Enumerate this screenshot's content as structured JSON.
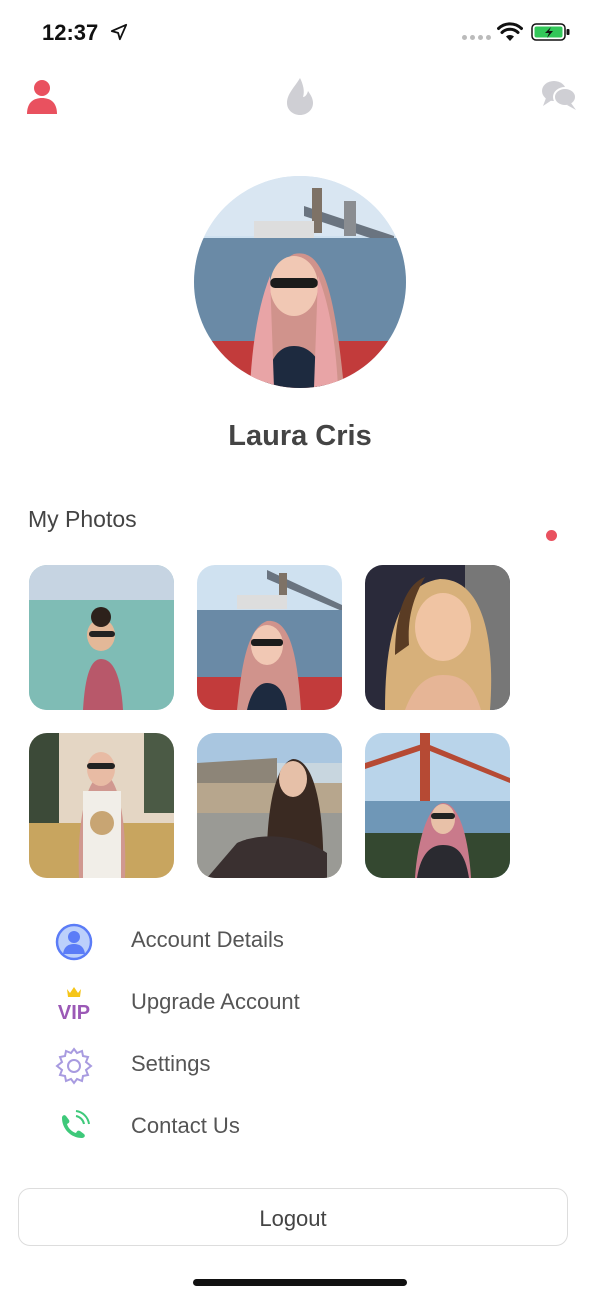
{
  "status_bar": {
    "time": "12:37"
  },
  "nav": {
    "icons": [
      "profile-icon",
      "flame-icon",
      "chat-icon"
    ],
    "active_color": "#e9515f",
    "inactive_color": "#cfcfd4"
  },
  "profile": {
    "name": "Laura Cris"
  },
  "photos": {
    "title": "My Photos",
    "count": 6
  },
  "menu": {
    "items": [
      {
        "label": "Account Details",
        "icon": "user-circle-icon"
      },
      {
        "label": "Upgrade Account",
        "icon": "vip-crown-icon"
      },
      {
        "label": "Settings",
        "icon": "gear-icon"
      },
      {
        "label": "Contact Us",
        "icon": "phone-icon"
      }
    ]
  },
  "logout_label": "Logout",
  "colors": {
    "accent": "#e9515f",
    "account_icon": "#5b7cf7",
    "vip": "#9b59b6",
    "phone": "#3ec97a",
    "gear": "#a89be0"
  }
}
